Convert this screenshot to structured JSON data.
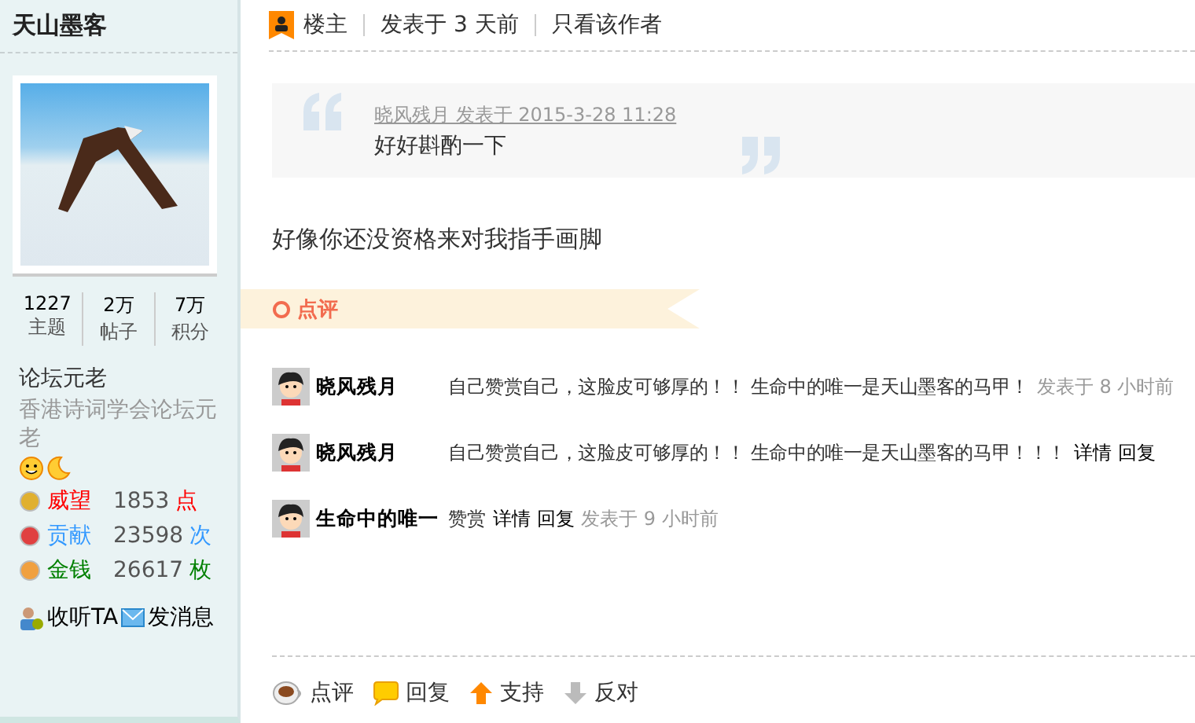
{
  "sidebar": {
    "username": "天山墨客",
    "stats": [
      {
        "value": "1227",
        "label": "主题"
      },
      {
        "value": "2万",
        "label": "帖子"
      },
      {
        "value": "7万",
        "label": "积分"
      }
    ],
    "rank": "论坛元老",
    "group": "香港诗词学会论坛元老",
    "credits": [
      {
        "kind": "prestige",
        "name": "威望",
        "value": "1853",
        "unit": "点",
        "color": "#ff0000"
      },
      {
        "kind": "contribution",
        "name": "贡献",
        "value": "23598",
        "unit": "次",
        "color": "#3399ff"
      },
      {
        "kind": "money",
        "name": "金钱",
        "value": "26617",
        "unit": "枚",
        "color": "#008000"
      }
    ],
    "actions": [
      {
        "kind": "follow",
        "label": "收听TA"
      },
      {
        "kind": "message",
        "label": "发消息"
      }
    ]
  },
  "post": {
    "badge": "楼主",
    "time": "发表于 3 天前",
    "author_only": "只看该作者",
    "quote": {
      "meta": "晓风残月 发表于 2015-3-28 11:28",
      "text": "好好斟酌一下"
    },
    "body": "好像你还没资格来对我指手画脚",
    "comment_heading": "点评",
    "comments": [
      {
        "author": "晓风残月",
        "text": "自己赞赏自己，这脸皮可够厚的！！ 生命中的唯一是天山墨客的马甲！",
        "time": "发表于 8 小时前"
      },
      {
        "author": "晓风残月",
        "text": "自己赞赏自己，这脸皮可够厚的！！ 生命中的唯一是天山墨客的马甲！！！",
        "links": [
          "详情",
          "回复"
        ]
      },
      {
        "author": "生命中的唯一",
        "text": "赞赏",
        "links": [
          "详情",
          "回复"
        ],
        "time": "发表于 9 小时前"
      }
    ],
    "footer": [
      {
        "kind": "rate",
        "label": "点评"
      },
      {
        "kind": "reply",
        "label": "回复"
      },
      {
        "kind": "support",
        "label": "支持"
      },
      {
        "kind": "oppose",
        "label": "反对"
      }
    ]
  }
}
